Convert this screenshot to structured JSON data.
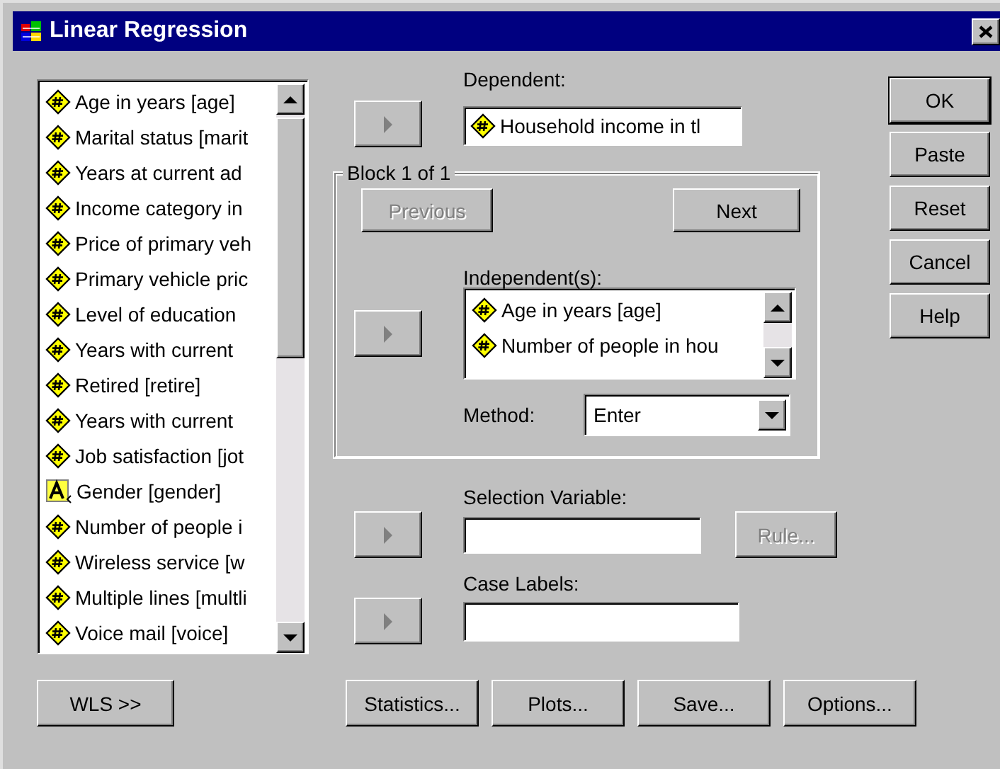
{
  "window": {
    "title": "Linear Regression"
  },
  "variable_list": {
    "items": [
      {
        "label": "Age in years [age]",
        "kind": "scale"
      },
      {
        "label": "Marital status [marit",
        "kind": "scale"
      },
      {
        "label": "Years at current ad",
        "kind": "scale"
      },
      {
        "label": "Income category in",
        "kind": "scale"
      },
      {
        "label": "Price of primary veh",
        "kind": "scale"
      },
      {
        "label": "Primary vehicle pric",
        "kind": "scale"
      },
      {
        "label": "Level of education",
        "kind": "scale"
      },
      {
        "label": "Years with current",
        "kind": "scale"
      },
      {
        "label": "Retired [retire]",
        "kind": "scale"
      },
      {
        "label": "Years with current",
        "kind": "scale"
      },
      {
        "label": "Job satisfaction [jot",
        "kind": "scale"
      },
      {
        "label": "Gender [gender]",
        "kind": "nominal"
      },
      {
        "label": "Number of people i",
        "kind": "scale"
      },
      {
        "label": "Wireless service [w",
        "kind": "scale"
      },
      {
        "label": "Multiple lines [multli",
        "kind": "scale"
      },
      {
        "label": "Voice mail [voice]",
        "kind": "scale"
      }
    ]
  },
  "dependent": {
    "label": "Dependent:",
    "value": {
      "label": "Household income in tl",
      "kind": "scale"
    }
  },
  "block": {
    "title": "Block 1 of 1",
    "buttons": [
      {
        "label": "Previous",
        "disabled": true
      },
      {
        "label": "Next",
        "disabled": false
      }
    ],
    "independents": {
      "label": "Independent(s):",
      "items": [
        {
          "label": "Age in years [age]",
          "kind": "scale"
        },
        {
          "label": "Number of people in hou",
          "kind": "scale"
        }
      ]
    },
    "method": {
      "label": "Method:",
      "value": "Enter"
    }
  },
  "selection_variable": {
    "label": "Selection Variable:",
    "rule_button": {
      "label": "Rule...",
      "disabled": true
    }
  },
  "case_labels": {
    "label": "Case Labels:"
  },
  "side_buttons": [
    {
      "label": "OK",
      "default": true
    },
    {
      "label": "Paste",
      "default": false
    },
    {
      "label": "Reset",
      "default": false
    },
    {
      "label": "Cancel",
      "default": false
    },
    {
      "label": "Help",
      "default": false
    }
  ],
  "bottom_buttons": [
    {
      "label": "WLS >>"
    },
    {
      "label": "Statistics..."
    },
    {
      "label": "Plots..."
    },
    {
      "label": "Save..."
    },
    {
      "label": "Options..."
    }
  ]
}
